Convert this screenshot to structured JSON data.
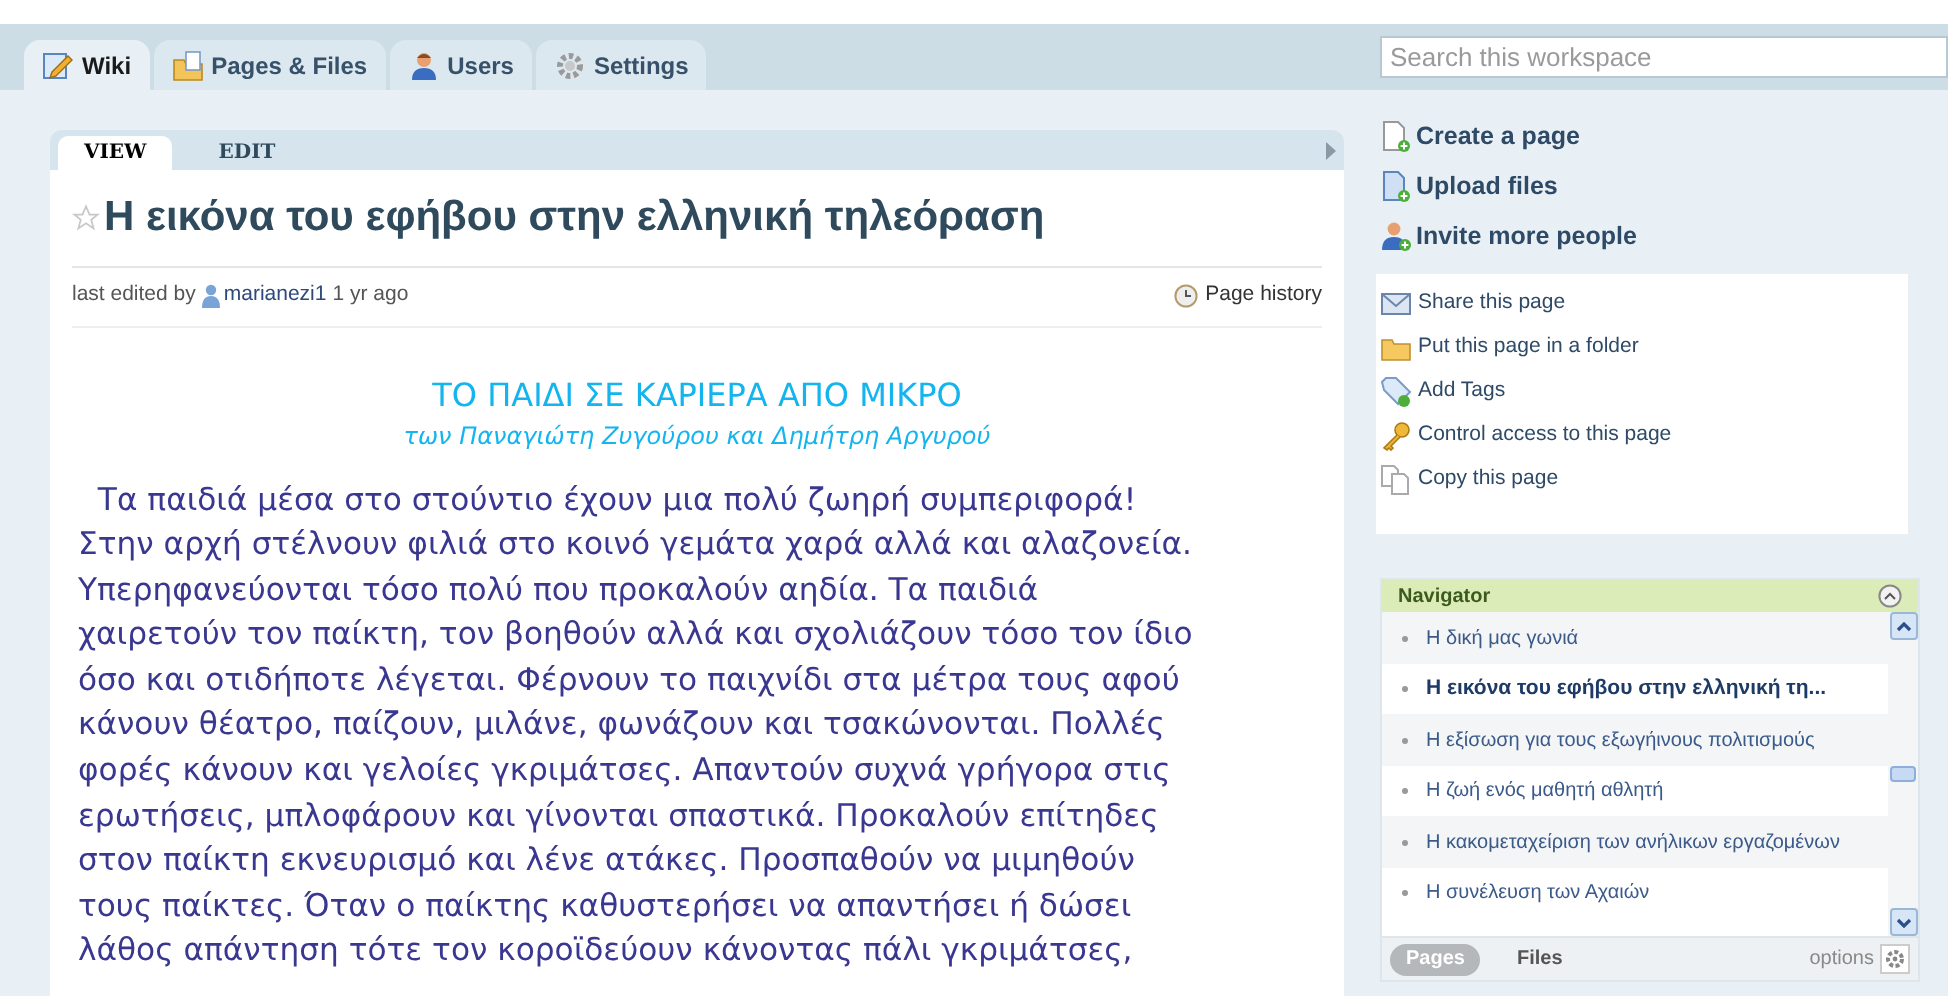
{
  "tabs": [
    {
      "label": "Wiki",
      "selected": true
    },
    {
      "label": "Pages & Files",
      "selected": false
    },
    {
      "label": "Users",
      "selected": false
    },
    {
      "label": "Settings",
      "selected": false
    }
  ],
  "search": {
    "placeholder": "Search this workspace"
  },
  "page_tabs": [
    {
      "label": "VIEW",
      "selected": true
    },
    {
      "label": "EDIT",
      "selected": false
    }
  ],
  "page": {
    "title": "Η εικόνα του εφήβου στην ελληνική τηλεόραση",
    "starred": false,
    "edited_prefix": "last edited by",
    "author": "marianezi1",
    "edited_time": "1 yr ago",
    "history": "Page history",
    "heading": "ΤΟ ΠΑΙΔΙ ΣΕ ΚΑΡΙΕΡΑ ΑΠΟ ΜΙΚΡΟ",
    "subheading": "των Παναγιώτη Ζυγούρου και Δημήτρη Αργυρού",
    "body_lines": [
      "  Τα παιδιά μέσα στο στούντιο έχουν μια πολύ ζωηρή συμπεριφορά!",
      "Στην αρχή στέλνουν φιλιά στο κοινό γεμάτα χαρά αλλά και αλαζονεία.",
      "Υπερηφανεύονται τόσο πολύ που προκαλούν αηδία. Τα παιδιά",
      "χαιρετούν τον παίκτη, τον βοηθούν αλλά και σχολιάζουν τόσο τον ίδιο",
      "όσο και οτιδήποτε λέγεται. Φέρνουν το παιχνίδι στα μέτρα τους αφού",
      "κάνουν θέατρο, παίζουν, μιλάνε, φωνάζουν και τσακώνονται. Πολλές",
      "φορές κάνουν και γελοίες γκριμάτσες. Απαντούν συχνά γρήγορα στις",
      "ερωτήσεις, μπλοφάρουν και γίνονται σπαστικά. Προκαλούν επίτηδες",
      "στον παίκτη εκνευρισμό και λένε ατάκες. Προσπαθούν να μιμηθούν",
      "τους παίκτες. Όταν ο παίκτης καθυστερήσει να απαντήσει ή δώσει",
      "λάθος απάντηση τότε τον κοροϊδεύουν κάνοντας πάλι γκριμάτσες,"
    ]
  },
  "actions": [
    "Create a page",
    "Upload files",
    "Invite more people"
  ],
  "page_actions": [
    "Share this page",
    "Put this page in a folder",
    "Add Tags",
    "Control access to this page",
    "Copy this page"
  ],
  "navigator": {
    "title": "Navigator",
    "items": [
      {
        "label": "Η δική μας γωνιά",
        "selected": false
      },
      {
        "label": "Η εικόνα του εφήβου στην ελληνική τη...",
        "selected": true
      },
      {
        "label": "Η εξίσωση για τους εξωγήινους πολιτισμούς",
        "selected": false
      },
      {
        "label": "Η ζωή ενός μαθητή αθλητή",
        "selected": false
      },
      {
        "label": "Η κακομεταχείριση των ανήλικων εργαζομένων",
        "selected": false
      },
      {
        "label": "Η συνέλευση των Αχαιών",
        "selected": false
      }
    ],
    "views": [
      {
        "label": "Pages",
        "selected": true
      },
      {
        "label": "Files",
        "selected": false
      }
    ],
    "options": "options"
  }
}
